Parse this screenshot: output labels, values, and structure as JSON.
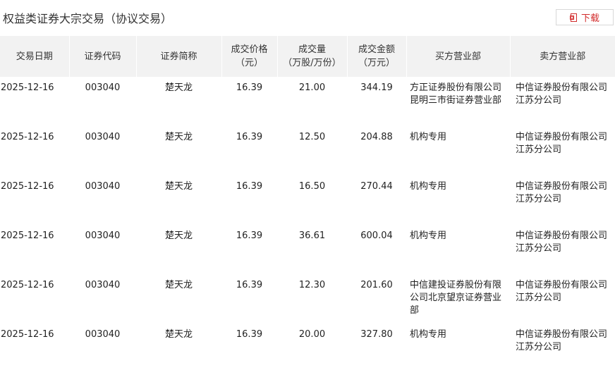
{
  "title": "权益类证券大宗交易（协议交易）",
  "download": {
    "label": "下载",
    "icon": "download-file-icon",
    "color": "#d22c2c"
  },
  "table": {
    "headers": [
      {
        "line1": "交易日期",
        "line2": ""
      },
      {
        "line1": "证券代码",
        "line2": ""
      },
      {
        "line1": "证券简称",
        "line2": ""
      },
      {
        "line1": "成交价格",
        "line2": "（元）"
      },
      {
        "line1": "成交量",
        "line2": "（万股/万份）"
      },
      {
        "line1": "成交金额",
        "line2": "（万元）"
      },
      {
        "line1": "买方营业部",
        "line2": ""
      },
      {
        "line1": "卖方营业部",
        "line2": ""
      }
    ],
    "rows": [
      {
        "date": "2025-12-16",
        "code": "003040",
        "name": "楚天龙",
        "price": "16.39",
        "volume": "21.00",
        "amount": "344.19",
        "buyer": "方正证券股份有限公司昆明三市街证券营业部",
        "seller": "中信证券股份有限公司江苏分公司"
      },
      {
        "date": "2025-12-16",
        "code": "003040",
        "name": "楚天龙",
        "price": "16.39",
        "volume": "12.50",
        "amount": "204.88",
        "buyer": "机构专用",
        "seller": "中信证券股份有限公司江苏分公司"
      },
      {
        "date": "2025-12-16",
        "code": "003040",
        "name": "楚天龙",
        "price": "16.39",
        "volume": "16.50",
        "amount": "270.44",
        "buyer": "机构专用",
        "seller": "中信证券股份有限公司江苏分公司"
      },
      {
        "date": "2025-12-16",
        "code": "003040",
        "name": "楚天龙",
        "price": "16.39",
        "volume": "36.61",
        "amount": "600.04",
        "buyer": "机构专用",
        "seller": "中信证券股份有限公司江苏分公司"
      },
      {
        "date": "2025-12-16",
        "code": "003040",
        "name": "楚天龙",
        "price": "16.39",
        "volume": "12.30",
        "amount": "201.60",
        "buyer": "中信建投证券股份有限公司北京望京证券营业部",
        "seller": "中信证券股份有限公司江苏分公司"
      },
      {
        "date": "2025-12-16",
        "code": "003040",
        "name": "楚天龙",
        "price": "16.39",
        "volume": "20.00",
        "amount": "327.80",
        "buyer": "机构专用",
        "seller": "中信证券股份有限公司江苏分公司"
      }
    ]
  }
}
